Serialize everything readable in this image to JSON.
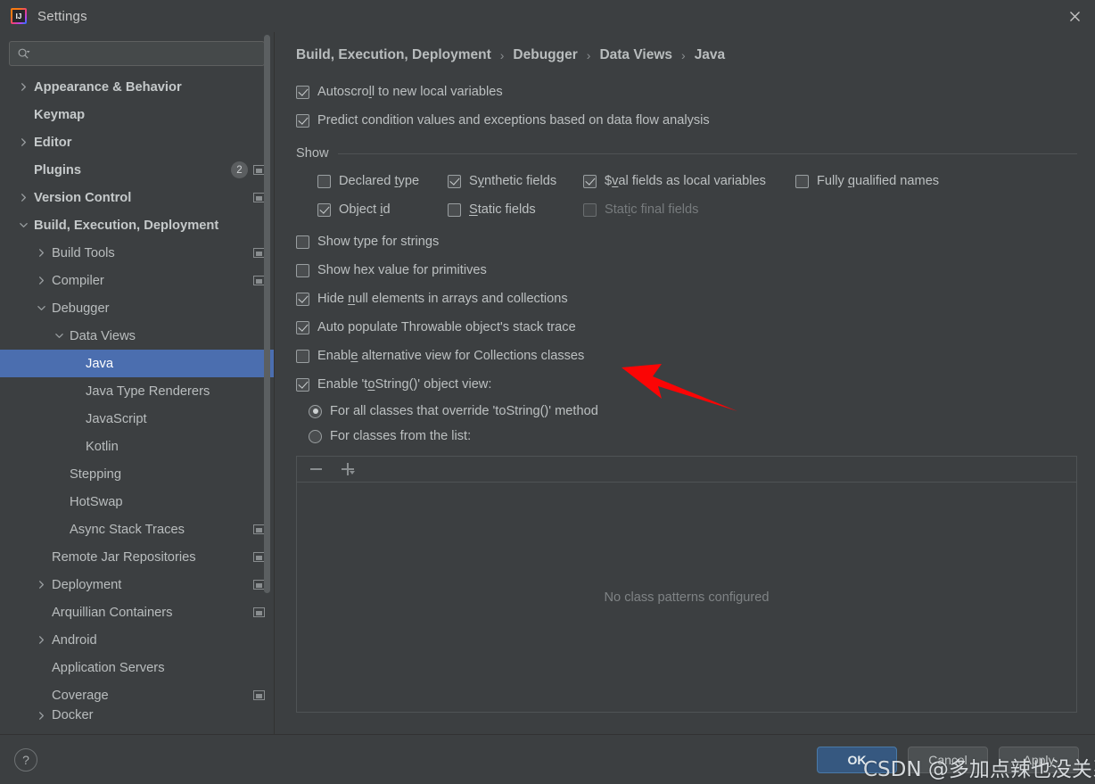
{
  "window": {
    "title": "Settings",
    "app_icon": "intellij-idea-icon",
    "close_icon": "close-icon"
  },
  "sidebar": {
    "search": {
      "placeholder": "",
      "value": "",
      "icon": "search-icon"
    },
    "items": [
      {
        "label": "Appearance & Behavior",
        "level": 0,
        "arrow": "collapsed",
        "bold": true
      },
      {
        "label": "Keymap",
        "level": 0,
        "arrow": "none",
        "bold": true
      },
      {
        "label": "Editor",
        "level": 0,
        "arrow": "collapsed",
        "bold": true
      },
      {
        "label": "Plugins",
        "level": 0,
        "arrow": "none",
        "bold": true,
        "badge": "2",
        "ext": true
      },
      {
        "label": "Version Control",
        "level": 0,
        "arrow": "collapsed",
        "bold": true,
        "ext": true
      },
      {
        "label": "Build, Execution, Deployment",
        "level": 0,
        "arrow": "expanded",
        "bold": true
      },
      {
        "label": "Build Tools",
        "level": 1,
        "arrow": "collapsed",
        "ext": true
      },
      {
        "label": "Compiler",
        "level": 1,
        "arrow": "collapsed",
        "ext": true
      },
      {
        "label": "Debugger",
        "level": 1,
        "arrow": "expanded"
      },
      {
        "label": "Data Views",
        "level": 2,
        "arrow": "expanded"
      },
      {
        "label": "Java",
        "level": 3,
        "arrow": "none",
        "selected": true
      },
      {
        "label": "Java Type Renderers",
        "level": 3,
        "arrow": "none"
      },
      {
        "label": "JavaScript",
        "level": 3,
        "arrow": "none"
      },
      {
        "label": "Kotlin",
        "level": 3,
        "arrow": "none"
      },
      {
        "label": "Stepping",
        "level": 2,
        "arrow": "none"
      },
      {
        "label": "HotSwap",
        "level": 2,
        "arrow": "none"
      },
      {
        "label": "Async Stack Traces",
        "level": 2,
        "arrow": "none",
        "ext": true
      },
      {
        "label": "Remote Jar Repositories",
        "level": 1,
        "arrow": "none",
        "ext": true
      },
      {
        "label": "Deployment",
        "level": 1,
        "arrow": "collapsed",
        "ext": true
      },
      {
        "label": "Arquillian Containers",
        "level": 1,
        "arrow": "none",
        "ext": true
      },
      {
        "label": "Android",
        "level": 1,
        "arrow": "collapsed"
      },
      {
        "label": "Application Servers",
        "level": 1,
        "arrow": "none"
      },
      {
        "label": "Coverage",
        "level": 1,
        "arrow": "none",
        "ext": true
      },
      {
        "label": "Docker",
        "level": 1,
        "arrow": "collapsed",
        "clipped": true
      }
    ]
  },
  "breadcrumb": {
    "separator": "›",
    "items": [
      "Build, Execution, Deployment",
      "Debugger",
      "Data Views",
      "Java"
    ]
  },
  "main": {
    "top_options": [
      {
        "label": "Autoscroll to new local variables",
        "mnemonic": "l",
        "checked": true
      },
      {
        "label": "Predict condition values and exceptions based on data flow analysis",
        "mnemonic": "",
        "checked": true
      }
    ],
    "show_group": {
      "title": "Show",
      "row1": [
        {
          "label": "Declared type",
          "mnemonic": "t",
          "checked": false
        },
        {
          "label": "Synthetic fields",
          "mnemonic": "y",
          "checked": true
        },
        {
          "label": "$val fields as local variables",
          "mnemonic": "v",
          "checked": true
        },
        {
          "label": "Fully qualified names",
          "mnemonic": "q",
          "checked": false
        }
      ],
      "row2": [
        {
          "label": "Object id",
          "mnemonic": "i",
          "checked": true
        },
        {
          "label": "Static fields",
          "mnemonic": "S",
          "checked": false
        },
        {
          "label": "Static final fields",
          "mnemonic": "i",
          "checked": false,
          "disabled": true
        }
      ]
    },
    "options": [
      {
        "label": "Show type for strings",
        "mnemonic": "",
        "checked": false
      },
      {
        "label": "Show hex value for primitives",
        "mnemonic": "",
        "checked": false
      },
      {
        "label": "Hide null elements in arrays and collections",
        "mnemonic": "n",
        "checked": true
      },
      {
        "label": "Auto populate Throwable object's stack trace",
        "mnemonic": "",
        "checked": true
      },
      {
        "label": "Enable alternative view for Collections classes",
        "mnemonic": "e",
        "checked": false
      }
    ],
    "tostring": {
      "label": "Enable 'toString()' object view:",
      "mnemonic": "o",
      "checked": true,
      "radios": [
        {
          "label": "For all classes that override 'toString()' method",
          "selected": true
        },
        {
          "label": "For classes from the list:",
          "selected": false
        }
      ]
    },
    "class_list": {
      "toolbar": {
        "remove_icon": "minus-icon",
        "add_icon": "plus-icon",
        "add_dropdown_icon": "chevron-down-icon"
      },
      "empty_text": "No class patterns configured"
    }
  },
  "footer": {
    "help_label": "?",
    "buttons": [
      {
        "label": "OK",
        "primary": true
      },
      {
        "label": "Cancel",
        "primary": false
      },
      {
        "label": "Apply",
        "primary": false
      }
    ]
  },
  "annotations": {
    "arrow_color": "#ff0000",
    "watermark": "CSDN @多加点辣也没关系"
  }
}
